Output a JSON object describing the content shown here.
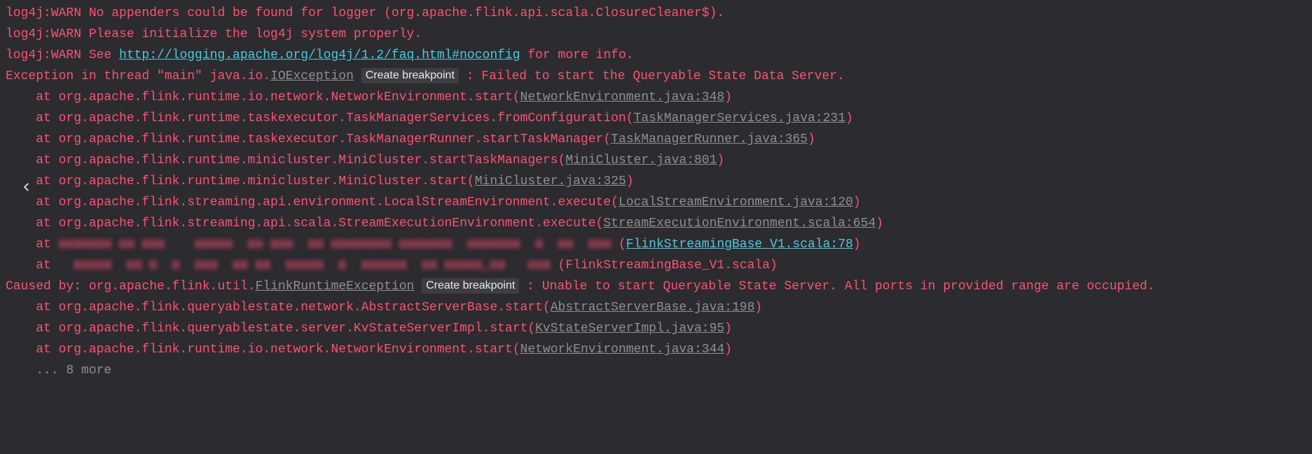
{
  "lines": [
    {
      "segments": [
        {
          "cls": "red",
          "text": "log4j:WARN No appenders could be found for logger (org.apache.flink.api.scala.ClosureCleaner$)."
        }
      ]
    },
    {
      "segments": [
        {
          "cls": "red",
          "text": "log4j:WARN Please initialize the log4j system properly."
        }
      ]
    },
    {
      "segments": [
        {
          "cls": "red",
          "text": "log4j:WARN See "
        },
        {
          "cls": "link-cyan",
          "name": "log4j-faq-link",
          "interact": true,
          "text": "http://logging.apache.org/log4j/1.2/faq.html#noconfig"
        },
        {
          "cls": "red",
          "text": " for more info."
        }
      ]
    },
    {
      "segments": [
        {
          "cls": "red",
          "text": "Exception in thread \"main\" java.io."
        },
        {
          "cls": "link-grey",
          "name": "ioexception-link",
          "interact": true,
          "text": "IOException"
        },
        {
          "cls": "red",
          "text": " "
        },
        {
          "cls": "bp",
          "name": "create-breakpoint-button",
          "interact": true,
          "text": "Create breakpoint"
        },
        {
          "cls": "red",
          "text": " : Failed to start the Queryable State Data Server."
        }
      ]
    },
    {
      "segments": [
        {
          "cls": "red",
          "text": "    at org.apache.flink.runtime.io.network.NetworkEnvironment.start("
        },
        {
          "cls": "link-grey",
          "name": "source-link",
          "interact": true,
          "text": "NetworkEnvironment.java:348"
        },
        {
          "cls": "red",
          "text": ")"
        }
      ]
    },
    {
      "segments": [
        {
          "cls": "red",
          "text": "    at org.apache.flink.runtime.taskexecutor.TaskManagerServices.fromConfiguration("
        },
        {
          "cls": "link-grey",
          "name": "source-link",
          "interact": true,
          "text": "TaskManagerServices.java:231"
        },
        {
          "cls": "red",
          "text": ")"
        }
      ]
    },
    {
      "segments": [
        {
          "cls": "red",
          "text": "    at org.apache.flink.runtime.taskexecutor.TaskManagerRunner.startTaskManager("
        },
        {
          "cls": "link-grey",
          "name": "source-link",
          "interact": true,
          "text": "TaskManagerRunner.java:365"
        },
        {
          "cls": "red",
          "text": ")"
        }
      ]
    },
    {
      "segments": [
        {
          "cls": "red",
          "text": "    at org.apache.flink.runtime.minicluster.MiniCluster.startTaskManagers("
        },
        {
          "cls": "link-grey",
          "name": "source-link",
          "interact": true,
          "text": "MiniCluster.java:801"
        },
        {
          "cls": "red",
          "text": ")"
        }
      ]
    },
    {
      "segments": [
        {
          "cls": "red",
          "text": "    at org.apache.flink.runtime.minicluster.MiniCluster.start("
        },
        {
          "cls": "link-grey",
          "name": "source-link",
          "interact": true,
          "text": "MiniCluster.java:325"
        },
        {
          "cls": "red",
          "text": ")"
        }
      ]
    },
    {
      "segments": [
        {
          "cls": "red",
          "text": "    at org.apache.flink.streaming.api.environment.LocalStreamEnvironment.execute("
        },
        {
          "cls": "link-grey",
          "name": "source-link",
          "interact": true,
          "text": "LocalStreamEnvironment.java:120"
        },
        {
          "cls": "red",
          "text": ")"
        }
      ]
    },
    {
      "segments": [
        {
          "cls": "red",
          "text": "    at org.apache.flink.streaming.api.scala.StreamExecutionEnvironment.execute("
        },
        {
          "cls": "link-grey",
          "name": "source-link",
          "interact": true,
          "text": "StreamExecutionEnvironment.scala:654"
        },
        {
          "cls": "red",
          "text": ")"
        }
      ]
    },
    {
      "segments": [
        {
          "cls": "red",
          "text": "    at "
        },
        {
          "cls": "blur",
          "text": "xxxxxxx xx xxx    xxxxx  xx xxx  xx xxxxxxxx xxxxxxx  xxxxxxx  x  xx  xxx "
        },
        {
          "cls": "red",
          "text": "("
        },
        {
          "cls": "link-cyan",
          "name": "source-link",
          "interact": true,
          "text": "FlinkStreamingBase_V1.scala:78"
        },
        {
          "cls": "red",
          "text": ")"
        }
      ]
    },
    {
      "segments": [
        {
          "cls": "red",
          "text": "    at "
        },
        {
          "cls": "blur",
          "text": "  xxxxx  xx x  x  xxx  xx xx  xxxxx  x  xxxxxx  xx xxxxx_xx   xxx "
        },
        {
          "cls": "red",
          "text": "(FlinkStreamingBase_V1.scala)"
        }
      ]
    },
    {
      "segments": [
        {
          "cls": "red",
          "text": "Caused by: org.apache.flink.util."
        },
        {
          "cls": "link-grey",
          "name": "flinkruntimeexception-link",
          "interact": true,
          "text": "FlinkRuntimeException"
        },
        {
          "cls": "red",
          "text": " "
        },
        {
          "cls": "bp",
          "name": "create-breakpoint-button",
          "interact": true,
          "text": "Create breakpoint"
        },
        {
          "cls": "red",
          "text": " : Unable to start Queryable State Server. All ports in provided range are occupied."
        }
      ]
    },
    {
      "segments": [
        {
          "cls": "red",
          "text": "    at org.apache.flink.queryablestate.network.AbstractServerBase.start("
        },
        {
          "cls": "link-grey",
          "name": "source-link",
          "interact": true,
          "text": "AbstractServerBase.java:198"
        },
        {
          "cls": "red",
          "text": ")"
        }
      ]
    },
    {
      "segments": [
        {
          "cls": "red",
          "text": "    at org.apache.flink.queryablestate.server.KvStateServerImpl.start("
        },
        {
          "cls": "link-grey",
          "name": "source-link",
          "interact": true,
          "text": "KvStateServerImpl.java:95"
        },
        {
          "cls": "red",
          "text": ")"
        }
      ]
    },
    {
      "segments": [
        {
          "cls": "red",
          "text": "    at org.apache.flink.runtime.io.network.NetworkEnvironment.start("
        },
        {
          "cls": "link-grey",
          "name": "source-link",
          "interact": true,
          "text": "NetworkEnvironment.java:344"
        },
        {
          "cls": "red",
          "text": ")"
        }
      ]
    },
    {
      "segments": [
        {
          "cls": "grey",
          "text": "    ... 8 more"
        }
      ]
    }
  ]
}
